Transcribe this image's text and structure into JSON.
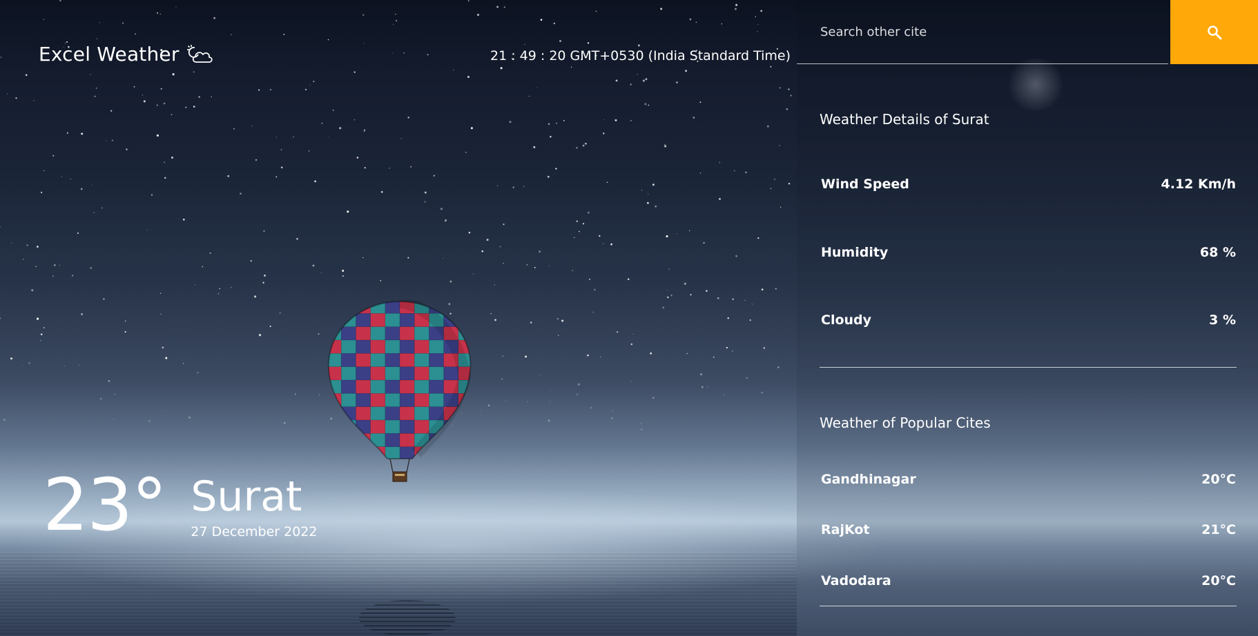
{
  "header": {
    "brand_name": "Excel Weather",
    "brand_icon": "cloud-moon-icon",
    "clock": "21 : 49 : 20 GMT+0530 (India Standard Time)"
  },
  "current": {
    "temperature": "23°",
    "city": "Surat",
    "date": "27 December 2022"
  },
  "search": {
    "placeholder": "Search other cite",
    "value": "",
    "button_icon": "search-icon",
    "button_color": "#ffa80a"
  },
  "details": {
    "title": "Weather Details of Surat",
    "rows": [
      {
        "label": "Wind Speed",
        "value": "4.12 Km/h"
      },
      {
        "label": "Humidity",
        "value": "68 %"
      },
      {
        "label": "Cloudy",
        "value": "3 %"
      }
    ]
  },
  "popular": {
    "title": "Weather of Popular Cites",
    "cities": [
      {
        "name": "Gandhinagar",
        "temp": "20°C"
      },
      {
        "name": "RajKot",
        "temp": "21°C"
      },
      {
        "name": "Vadodara",
        "temp": "20°C"
      }
    ]
  }
}
